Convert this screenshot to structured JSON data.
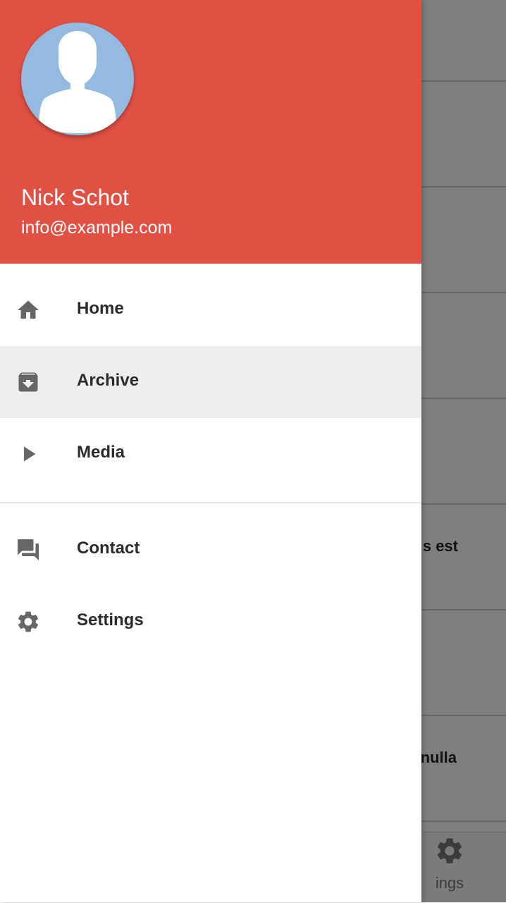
{
  "drawer": {
    "user": {
      "name": "Nick Schot",
      "email": "info@example.com"
    },
    "primary_items": [
      {
        "label": "Home",
        "icon": "home-icon",
        "active": false
      },
      {
        "label": "Archive",
        "icon": "archive-icon",
        "active": true
      },
      {
        "label": "Media",
        "icon": "play-icon",
        "active": false
      }
    ],
    "secondary_items": [
      {
        "label": "Contact",
        "icon": "chat-icon"
      },
      {
        "label": "Settings",
        "icon": "gear-icon"
      }
    ]
  },
  "background": {
    "visible_fragments": [
      "s est",
      "nulla"
    ],
    "bottom_nav_label_fragment": "ings"
  },
  "colors": {
    "header": "#e05143",
    "active_item": "#eeeeee",
    "avatar_bg": "#94bbdf",
    "icon": "#666666",
    "scrim": "rgba(0,0,0,0.5)"
  }
}
